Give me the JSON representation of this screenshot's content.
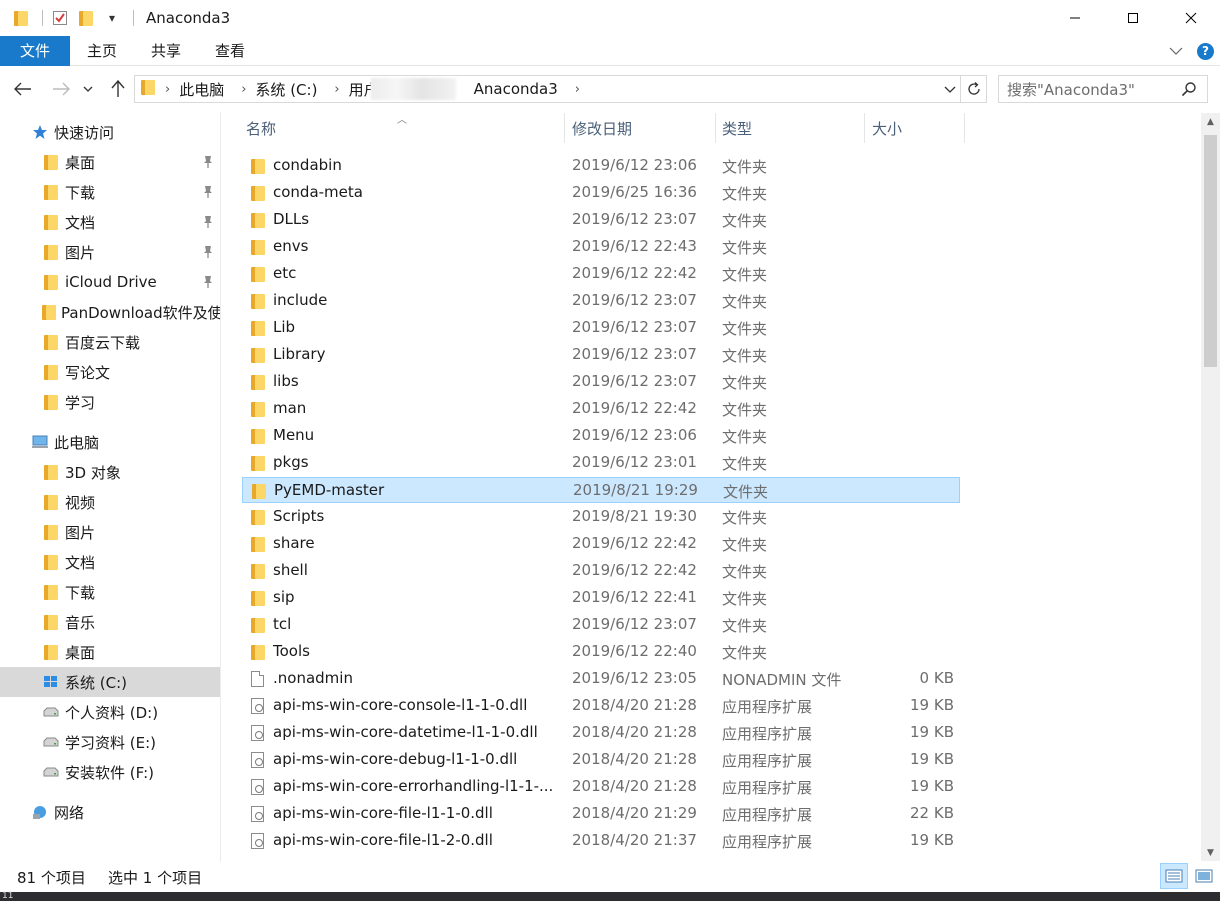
{
  "window": {
    "title": "Anaconda3",
    "qat_dropdown": "▾"
  },
  "ribbon": {
    "tabs": [
      "文件",
      "主页",
      "共享",
      "查看"
    ]
  },
  "address": {
    "crumbs": [
      "此电脑",
      "系统 (C:)",
      "用户",
      "Anaconda3"
    ],
    "search_placeholder": "搜索\"Anaconda3\""
  },
  "sidebar": {
    "items": [
      {
        "label": "快速访问",
        "icon": "star-icon",
        "pinned": false,
        "indent": 0
      },
      {
        "label": "桌面",
        "icon": "desktop-folder-icon",
        "pinned": true,
        "indent": 1
      },
      {
        "label": "下载",
        "icon": "download-folder-icon",
        "pinned": true,
        "indent": 1
      },
      {
        "label": "文档",
        "icon": "document-folder-icon",
        "pinned": true,
        "indent": 1
      },
      {
        "label": "图片",
        "icon": "pictures-folder-icon",
        "pinned": true,
        "indent": 1
      },
      {
        "label": "iCloud Drive",
        "icon": "folder-icon",
        "pinned": true,
        "indent": 1
      },
      {
        "label": "PanDownload软件及使",
        "icon": "folder-icon",
        "pinned": false,
        "indent": 1
      },
      {
        "label": "百度云下载",
        "icon": "folder-icon",
        "pinned": false,
        "indent": 1
      },
      {
        "label": "写论文",
        "icon": "folder-icon",
        "pinned": false,
        "indent": 1
      },
      {
        "label": "学习",
        "icon": "folder-icon",
        "pinned": false,
        "indent": 1
      },
      {
        "label": "此电脑",
        "icon": "computer-icon",
        "pinned": false,
        "indent": 0
      },
      {
        "label": "3D 对象",
        "icon": "3d-objects-icon",
        "pinned": false,
        "indent": 1
      },
      {
        "label": "视频",
        "icon": "video-folder-icon",
        "pinned": false,
        "indent": 1
      },
      {
        "label": "图片",
        "icon": "pictures-folder-icon",
        "pinned": false,
        "indent": 1
      },
      {
        "label": "文档",
        "icon": "document-folder-icon",
        "pinned": false,
        "indent": 1
      },
      {
        "label": "下载",
        "icon": "download-folder-icon",
        "pinned": false,
        "indent": 1
      },
      {
        "label": "音乐",
        "icon": "music-folder-icon",
        "pinned": false,
        "indent": 1
      },
      {
        "label": "桌面",
        "icon": "desktop-folder-icon",
        "pinned": false,
        "indent": 1
      },
      {
        "label": "系统 (C:)",
        "icon": "windows-drive-icon",
        "pinned": false,
        "indent": 1,
        "selected": true
      },
      {
        "label": "个人资料 (D:)",
        "icon": "drive-icon",
        "pinned": false,
        "indent": 1
      },
      {
        "label": "学习资料 (E:)",
        "icon": "drive-icon",
        "pinned": false,
        "indent": 1
      },
      {
        "label": "安装软件 (F:)",
        "icon": "drive-icon",
        "pinned": false,
        "indent": 1
      },
      {
        "label": "网络",
        "icon": "network-icon",
        "pinned": false,
        "indent": 0
      }
    ]
  },
  "columns": {
    "name": "名称",
    "date": "修改日期",
    "type": "类型",
    "size": "大小"
  },
  "files": [
    {
      "name": "condabin",
      "date": "2019/6/12 23:06",
      "type": "文件夹",
      "size": "",
      "kind": "folder"
    },
    {
      "name": "conda-meta",
      "date": "2019/6/25 16:36",
      "type": "文件夹",
      "size": "",
      "kind": "folder"
    },
    {
      "name": "DLLs",
      "date": "2019/6/12 23:07",
      "type": "文件夹",
      "size": "",
      "kind": "folder"
    },
    {
      "name": "envs",
      "date": "2019/6/12 22:43",
      "type": "文件夹",
      "size": "",
      "kind": "folder"
    },
    {
      "name": "etc",
      "date": "2019/6/12 22:42",
      "type": "文件夹",
      "size": "",
      "kind": "folder"
    },
    {
      "name": "include",
      "date": "2019/6/12 23:07",
      "type": "文件夹",
      "size": "",
      "kind": "folder"
    },
    {
      "name": "Lib",
      "date": "2019/6/12 23:07",
      "type": "文件夹",
      "size": "",
      "kind": "folder"
    },
    {
      "name": "Library",
      "date": "2019/6/12 23:07",
      "type": "文件夹",
      "size": "",
      "kind": "folder"
    },
    {
      "name": "libs",
      "date": "2019/6/12 23:07",
      "type": "文件夹",
      "size": "",
      "kind": "folder"
    },
    {
      "name": "man",
      "date": "2019/6/12 22:42",
      "type": "文件夹",
      "size": "",
      "kind": "folder"
    },
    {
      "name": "Menu",
      "date": "2019/6/12 23:06",
      "type": "文件夹",
      "size": "",
      "kind": "folder"
    },
    {
      "name": "pkgs",
      "date": "2019/6/12 23:01",
      "type": "文件夹",
      "size": "",
      "kind": "folder"
    },
    {
      "name": "PyEMD-master",
      "date": "2019/8/21 19:29",
      "type": "文件夹",
      "size": "",
      "kind": "folder",
      "selected": true
    },
    {
      "name": "Scripts",
      "date": "2019/8/21 19:30",
      "type": "文件夹",
      "size": "",
      "kind": "folder"
    },
    {
      "name": "share",
      "date": "2019/6/12 22:42",
      "type": "文件夹",
      "size": "",
      "kind": "folder"
    },
    {
      "name": "shell",
      "date": "2019/6/12 22:42",
      "type": "文件夹",
      "size": "",
      "kind": "folder"
    },
    {
      "name": "sip",
      "date": "2019/6/12 22:41",
      "type": "文件夹",
      "size": "",
      "kind": "folder"
    },
    {
      "name": "tcl",
      "date": "2019/6/12 23:07",
      "type": "文件夹",
      "size": "",
      "kind": "folder"
    },
    {
      "name": "Tools",
      "date": "2019/6/12 22:40",
      "type": "文件夹",
      "size": "",
      "kind": "folder"
    },
    {
      "name": ".nonadmin",
      "date": "2019/6/12 23:05",
      "type": "NONADMIN 文件",
      "size": "0 KB",
      "kind": "file"
    },
    {
      "name": "api-ms-win-core-console-l1-1-0.dll",
      "date": "2018/4/20 21:28",
      "type": "应用程序扩展",
      "size": "19 KB",
      "kind": "dll"
    },
    {
      "name": "api-ms-win-core-datetime-l1-1-0.dll",
      "date": "2018/4/20 21:28",
      "type": "应用程序扩展",
      "size": "19 KB",
      "kind": "dll"
    },
    {
      "name": "api-ms-win-core-debug-l1-1-0.dll",
      "date": "2018/4/20 21:28",
      "type": "应用程序扩展",
      "size": "19 KB",
      "kind": "dll"
    },
    {
      "name": "api-ms-win-core-errorhandling-l1-1-...",
      "date": "2018/4/20 21:28",
      "type": "应用程序扩展",
      "size": "19 KB",
      "kind": "dll"
    },
    {
      "name": "api-ms-win-core-file-l1-1-0.dll",
      "date": "2018/4/20 21:29",
      "type": "应用程序扩展",
      "size": "22 KB",
      "kind": "dll"
    },
    {
      "name": "api-ms-win-core-file-l1-2-0.dll",
      "date": "2018/4/20 21:37",
      "type": "应用程序扩展",
      "size": "19 KB",
      "kind": "dll"
    }
  ],
  "status": {
    "count": "81 个项目",
    "selection": "选中 1 个项目"
  },
  "taskbar": {
    "fragment": "11"
  },
  "colors": {
    "accent": "#1979ca",
    "selection_bg": "#cce8ff",
    "selection_border": "#99d1ff",
    "sidebar_selected": "#d9d9d9",
    "folder": "#fcd667"
  }
}
